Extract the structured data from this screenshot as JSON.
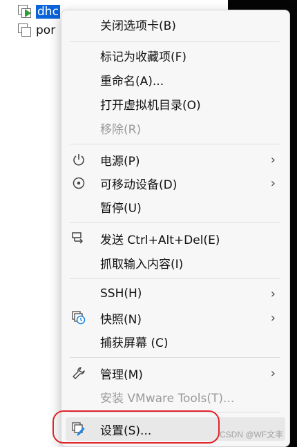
{
  "tree": {
    "items": [
      {
        "label": "dhc",
        "selected": true,
        "running": true
      },
      {
        "label": "por",
        "selected": false,
        "running": false
      }
    ]
  },
  "menu": {
    "items": [
      {
        "label": "关闭选项卡(B)"
      },
      {
        "label": "标记为收藏项(F)"
      },
      {
        "label": "重命名(A)..."
      },
      {
        "label": "打开虚拟机目录(O)"
      },
      {
        "label": "移除(R)",
        "disabled": true
      },
      {
        "label": "电源(P)",
        "icon": "power-icon",
        "submenu": true
      },
      {
        "label": "可移动设备(D)",
        "icon": "disc-icon",
        "submenu": true
      },
      {
        "label": "暂停(U)"
      },
      {
        "label": "发送 Ctrl+Alt+Del(E)",
        "icon": "send-keys-icon"
      },
      {
        "label": "抓取输入内容(I)"
      },
      {
        "label": "SSH(H)",
        "submenu": true
      },
      {
        "label": "快照(N)",
        "icon": "snapshot-icon",
        "submenu": true
      },
      {
        "label": "捕获屏幕 (C)"
      },
      {
        "label": "管理(M)",
        "icon": "wrench-icon",
        "submenu": true
      },
      {
        "label": "安装 VMware Tools(T)...",
        "disabled": true
      },
      {
        "label": "设置(S)...",
        "icon": "settings-icon",
        "highlighted": true
      }
    ]
  },
  "watermark": "CSDN @WF文丰",
  "colors": {
    "selection": "#0a63d8",
    "annotation": "#e0242b",
    "play": "#2e9d35"
  }
}
